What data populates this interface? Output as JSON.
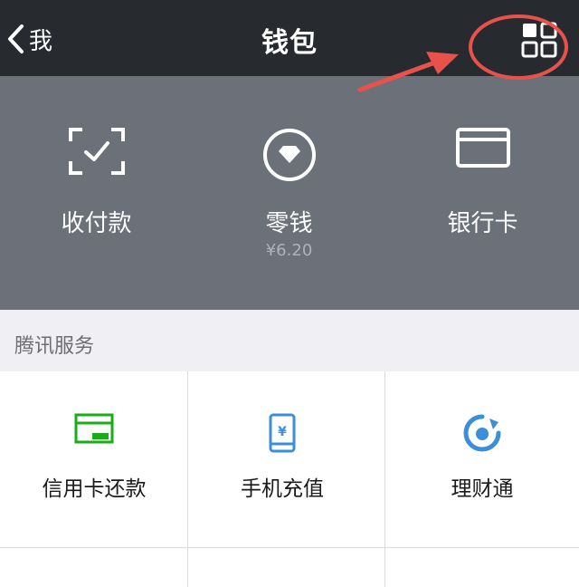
{
  "navbar": {
    "back_label": "我",
    "title": "钱包"
  },
  "wallet": {
    "items": [
      {
        "label": "收付款",
        "icon": "scan-check-icon"
      },
      {
        "label": "零钱",
        "sub": "¥6.20",
        "icon": "diamond-coin-icon"
      },
      {
        "label": "银行卡",
        "icon": "bank-card-icon"
      }
    ]
  },
  "services": {
    "header": "腾讯服务",
    "items": [
      {
        "label": "信用卡还款",
        "icon": "credit-card-icon",
        "color": "#1aad19"
      },
      {
        "label": "手机充值",
        "icon": "phone-topup-icon",
        "color": "#3b8fd9"
      },
      {
        "label": "理财通",
        "icon": "licaitong-icon",
        "color": "#3b8fd9"
      }
    ]
  },
  "colors": {
    "navbar_bg": "#272b30",
    "wallet_bg": "#6b7079",
    "annotation": "#e8524a"
  }
}
